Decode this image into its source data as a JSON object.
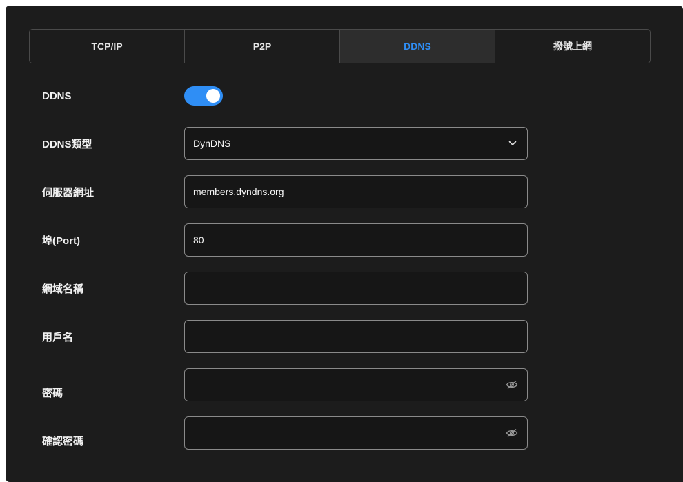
{
  "tabs": [
    {
      "label": "TCP/IP"
    },
    {
      "label": "P2P"
    },
    {
      "label": "DDNS"
    },
    {
      "label": "撥號上網"
    }
  ],
  "active_tab_index": 2,
  "colors": {
    "accent": "#2f8ef5",
    "panel_bg": "#1c1c1c",
    "field_border": "#8a8a8a"
  },
  "form": {
    "ddns": {
      "label": "DDNS",
      "enabled": true
    },
    "ddns_type": {
      "label": "DDNS類型",
      "value": "DynDNS",
      "icon": "chevron-down-icon"
    },
    "server": {
      "label": "伺服器網址",
      "value": "members.dyndns.org"
    },
    "port": {
      "label": "埠(Port)",
      "value": "80"
    },
    "domain": {
      "label": "網域名稱",
      "value": ""
    },
    "username": {
      "label": "用戶名",
      "value": ""
    },
    "password": {
      "label": "密碼",
      "value": "",
      "icon": "eye-off-icon"
    },
    "confirm_password": {
      "label": "確認密碼",
      "value": "",
      "icon": "eye-off-icon"
    }
  }
}
